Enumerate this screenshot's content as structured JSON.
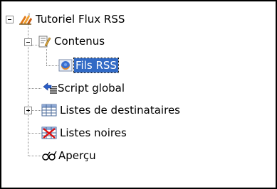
{
  "tree": {
    "root": {
      "label": "Tutoriel Flux RSS",
      "icon": "rss-feed-wizard-icon",
      "expanded": true
    },
    "contenus": {
      "label": "Contenus",
      "icon": "document-edit-icon",
      "expanded": true
    },
    "fils_rss": {
      "label": "Fils RSS",
      "icon": "firefox-feed-icon",
      "selected": true
    },
    "script_global": {
      "label": "Script global",
      "icon": "script-icon"
    },
    "listes_destinataires": {
      "label": "Listes de destinataires",
      "icon": "table-grid-icon",
      "expanded": false
    },
    "listes_noires": {
      "label": "Listes noires",
      "icon": "blacklist-table-icon"
    },
    "apercu": {
      "label": "Aperçu",
      "icon": "glasses-icon"
    }
  },
  "colors": {
    "selection": "#316ac5",
    "selection_text": "#ffffff",
    "tree_lines": "#8a8a8a"
  }
}
